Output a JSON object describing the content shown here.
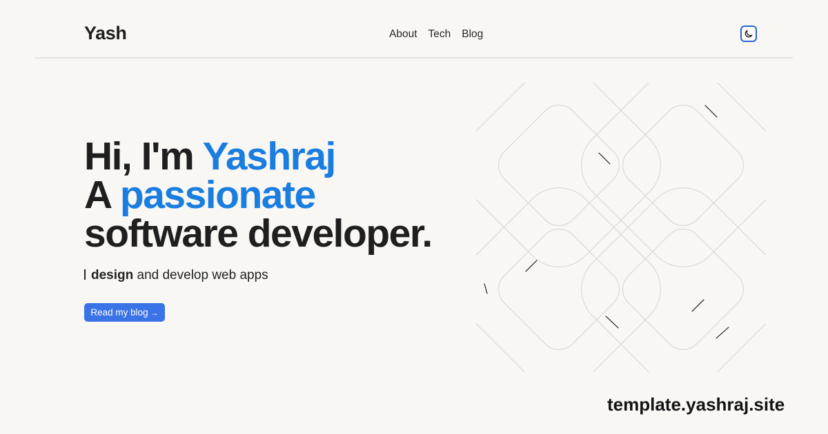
{
  "header": {
    "brand": "Yash",
    "nav": [
      {
        "label": "About"
      },
      {
        "label": "Tech"
      },
      {
        "label": "Blog"
      }
    ],
    "theme_toggle_icon": "moon-icon"
  },
  "hero": {
    "line1_prefix": "Hi, I'm ",
    "line1_accent": "Yashraj",
    "line2_prefix": "A ",
    "line2_accent": "passionate",
    "line3": "software developer.",
    "accent_color": "#1a7de0"
  },
  "tagline": {
    "strong": "design",
    "rest": " and develop web apps",
    "leading": "I"
  },
  "cta": {
    "label": "Read my blog",
    "arrow": "→"
  },
  "footer": {
    "url": "template.yashraj.site"
  },
  "colors": {
    "background": "#f8f7f3",
    "button": "#3a73e6",
    "toggle_border": "#2a63d6"
  }
}
